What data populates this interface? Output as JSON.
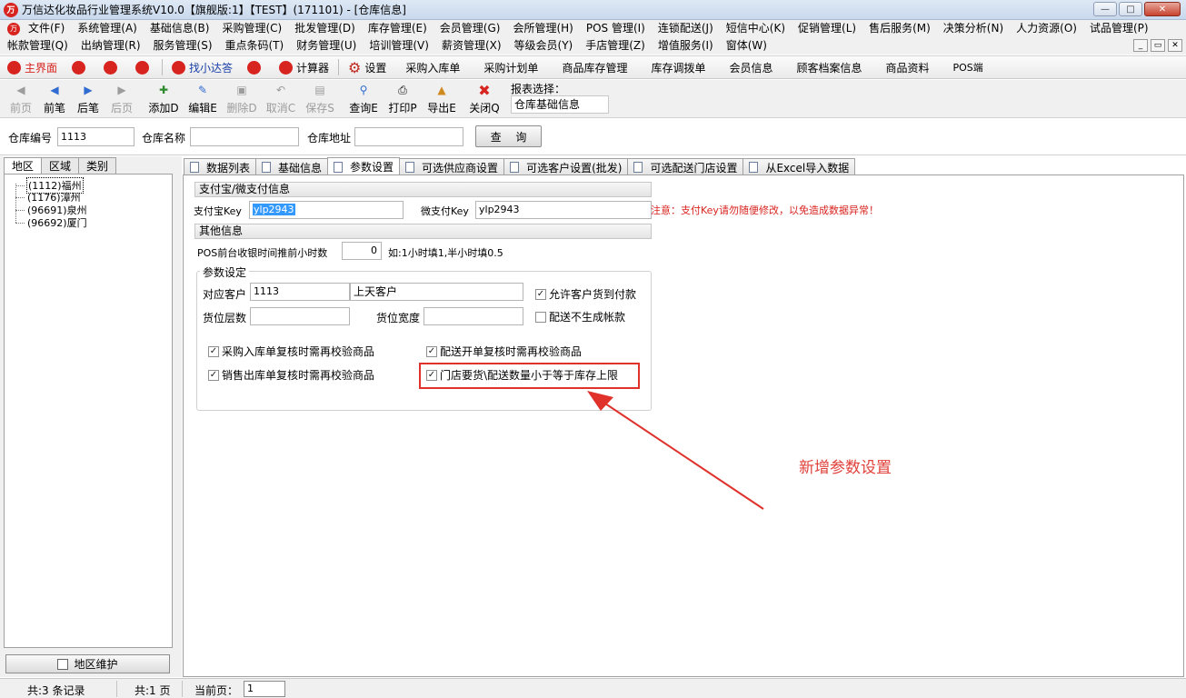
{
  "window": {
    "title": "万信达化妆品行业管理系统V10.0【旗舰版:1】【TEST】(171101) - [仓库信息]",
    "logo_text": "万",
    "controls": [
      "minimize",
      "maximize",
      "close"
    ]
  },
  "menu_row1": [
    "文件(F)",
    "系统管理(A)",
    "基础信息(B)",
    "采购管理(C)",
    "批发管理(D)",
    "库存管理(E)",
    "会员管理(G)",
    "会所管理(H)",
    "POS 管理(I)",
    "连锁配送(J)",
    "短信中心(K)",
    "促销管理(L)",
    "售后服务(M)",
    "决策分析(N)",
    "人力资源(O)",
    "试品管理(P)"
  ],
  "menu_row2": [
    "帐款管理(Q)",
    "出纳管理(R)",
    "服务管理(S)",
    "重点条码(T)",
    "财务管理(U)",
    "培训管理(V)",
    "薪资管理(X)",
    "等级会员(Y)",
    "手店管理(Z)",
    "增值服务(I)",
    "窗体(W)"
  ],
  "quickbar": {
    "home": "主界面",
    "assistant": "找小达答",
    "calculator": "计算器",
    "settings": "设置",
    "links": [
      "采购入库单",
      "采购计划单",
      "商品库存管理",
      "库存调拨单",
      "会员信息",
      "顾客档案信息",
      "商品资料",
      "POS端"
    ]
  },
  "actions": {
    "prev_page": "前页",
    "prev": "前笔",
    "next": "后笔",
    "next_page": "后页",
    "add": "添加D",
    "edit": "编辑E",
    "delete": "删除D",
    "cancel": "取消C",
    "save": "保存S",
    "query": "查询E",
    "print": "打印P",
    "export": "导出E",
    "close": "关闭Q",
    "report_label": "报表选择：",
    "report_value": "仓库基础信息"
  },
  "filter": {
    "code_label": "仓库编号",
    "code_value": "1113",
    "name_label": "仓库名称",
    "name_value": "",
    "address_label": "仓库地址",
    "address_value": "",
    "query_button": "查 询"
  },
  "left": {
    "tabs": [
      "地区",
      "区域",
      "类别"
    ],
    "tree": [
      "(1112)福州",
      "(1176)漳州",
      "(96691)泉州",
      "(96692)厦门"
    ],
    "maintain_button": "地区维护"
  },
  "tabs": [
    "数据列表",
    "基础信息",
    "参数设置",
    "可选供应商设置",
    "可选客户设置(批发)",
    "可选配送门店设置",
    "从Excel导入数据"
  ],
  "params": {
    "payment_section": "支付宝/微支付信息",
    "alipay_label": "支付宝Key",
    "alipay_value": "ylp2943",
    "wechat_label": "微支付Key",
    "wechat_value": "ylp2943",
    "warning": "注意：支付Key请勿随便修改，以免造成数据异常！",
    "other_section": "其他信息",
    "pos_label": "POS前台收银时间推前小时数",
    "pos_value": "0",
    "pos_hint": "如:1小时填1,半小时填0.5",
    "group_title": "参数设定",
    "customer_label": "对应客户",
    "customer_code": "1113",
    "customer_name": "上天客户",
    "allow_cod_label": "允许客户货到付款",
    "allow_cod_checked": true,
    "shelf_layers_label": "货位层数",
    "shelf_layers_value": "",
    "shelf_width_label": "货位宽度",
    "shelf_width_value": "",
    "no_account_label": "配送不生成帐款",
    "no_account_checked": false,
    "check1_label": "采购入库单复核时需再校验商品",
    "check1_checked": true,
    "check2_label": "配送开单复核时需再校验商品",
    "check2_checked": true,
    "check3_label": "销售出库单复核时需再校验商品",
    "check3_checked": true,
    "check4_label": "门店要货\\配送数量小于等于库存上限",
    "check4_checked": true
  },
  "annotation": "新增参数设置",
  "status": {
    "records": "共:3 条记录",
    "pages": "共:1 页",
    "current_label": "当前页：",
    "current_value": "1"
  },
  "colors": {
    "accent_red": "#d8241f",
    "annotation_red": "#e0312a",
    "selection_blue": "#3399ff"
  }
}
